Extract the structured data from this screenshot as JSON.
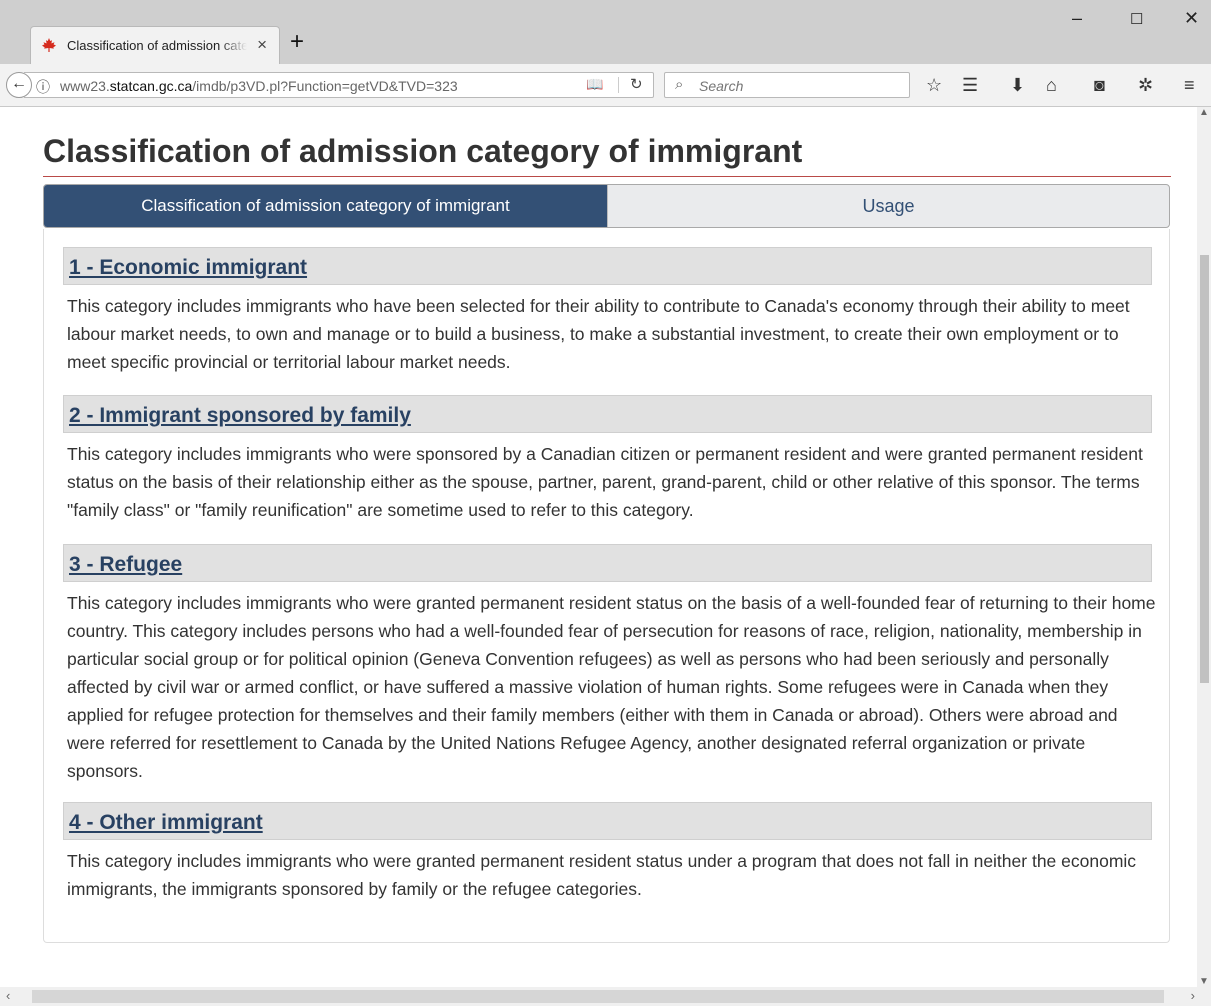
{
  "browser": {
    "tab_title": "Classification of admission category of immigrant",
    "tab_close": "×",
    "new_tab": "+",
    "window_controls": {
      "minimize": "–",
      "maximize": "☐",
      "close": "✕"
    },
    "url_prefix": "www23.",
    "url_domain": "statcan.gc.ca",
    "url_path": "/imdb/p3VD.pl?Function=getVD&TVD=323",
    "search_placeholder": "Search",
    "icons": {
      "back": "back-arrow-icon",
      "site_info": "info-icon",
      "reader": "reader-view-icon",
      "reload": "reload-icon",
      "search": "search-icon",
      "bookmark": "star-icon",
      "library": "bookmark-list-icon",
      "downloads": "download-icon",
      "home": "home-icon",
      "pocket": "pocket-icon",
      "extension": "extension-icon",
      "menu": "hamburger-menu-icon"
    }
  },
  "page": {
    "title": "Classification of admission category of immigrant",
    "tabs": [
      {
        "label": "Classification of admission category of immigrant",
        "active": true
      },
      {
        "label": "Usage",
        "active": false
      }
    ],
    "categories": [
      {
        "heading": "1 - Economic immigrant",
        "description": "This category includes immigrants who have been selected for their ability to contribute to Canada's economy through their ability to meet labour market needs, to own and manage or to build a business, to make a substantial investment, to create their own employment or to meet specific provincial or territorial labour market needs."
      },
      {
        "heading": "2 - Immigrant sponsored by family",
        "description": "This category includes immigrants who were sponsored by a Canadian citizen or permanent resident and were granted permanent resident status on the basis of their relationship either as the spouse, partner, parent, grand-parent, child or other relative of this sponsor. The terms \"family class\" or \"family reunification\" are sometime used to refer to this category."
      },
      {
        "heading": "3 - Refugee",
        "description": "This category includes immigrants who were granted permanent resident status on the basis of a well-founded fear of returning to their home country. This category includes persons who had a well-founded fear of persecution for reasons of race, religion, nationality, membership in particular social group or for political opinion (Geneva Convention refugees) as well as persons who had been seriously and personally affected by civil war or armed conflict, or have suffered a massive violation of human rights. Some refugees were in Canada when they applied for refugee protection for themselves and their family members (either with them in Canada or abroad). Others were abroad and were referred for resettlement to Canada by the United Nations Refugee Agency, another designated referral organization or private sponsors."
      },
      {
        "heading": "4 - Other immigrant",
        "description": "This category includes immigrants who were granted permanent resident status under a program that does not fall in neither the economic immigrants, the immigrants sponsored by family or the refugee categories."
      }
    ]
  },
  "colors": {
    "active_tab": "#335075",
    "link": "#284162",
    "title_rule": "#b94a48",
    "section_bg": "#e1e1e1"
  }
}
